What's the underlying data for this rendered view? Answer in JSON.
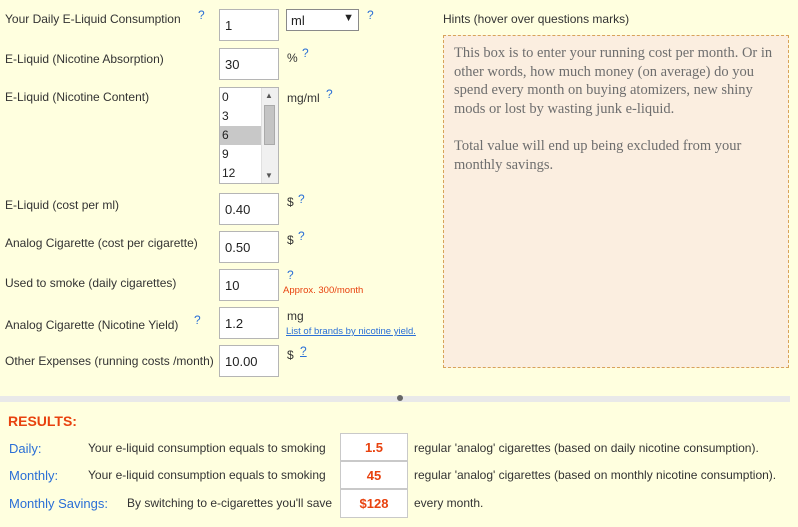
{
  "form": {
    "daily_consumption": {
      "label": "Your Daily E-Liquid Consumption",
      "value": "1",
      "unit_selected": "ml"
    },
    "nicotine_absorption": {
      "label": "E-Liquid (Nicotine Absorption)",
      "value": "30",
      "unit": "%"
    },
    "nicotine_content": {
      "label": "E-Liquid (Nicotine Content)",
      "options": [
        "0",
        "3",
        "6",
        "9",
        "12"
      ],
      "selected": "6",
      "unit": "mg/ml"
    },
    "cost_per_ml": {
      "label": "E-Liquid (cost per ml)",
      "value": "0.40",
      "unit": "$"
    },
    "cost_per_cigarette": {
      "label": "Analog Cigarette (cost per cigarette)",
      "value": "0.50",
      "unit": "$"
    },
    "daily_cigarettes": {
      "label": "Used to smoke (daily cigarettes)",
      "value": "10",
      "note": "Approx. 300/month"
    },
    "nicotine_yield": {
      "label": "Analog Cigarette (Nicotine Yield)",
      "value": "1.2",
      "unit": "mg",
      "link": "List of brands by nicotine yield."
    },
    "other_expenses": {
      "label": "Other Expenses (running costs /month)",
      "value": "10.00",
      "unit": "$"
    },
    "question_mark": "?"
  },
  "hints": {
    "title": "Hints (hover over questions marks)",
    "paragraph1": "This box is to enter your running cost per month. Or in other words, how much money (on average) do you spend every month on buying atomizers, new shiny mods or lost by wasting junk e-liquid.",
    "paragraph2": "Total value will end up being excluded from your monthly savings."
  },
  "results": {
    "title": "RESULTS:",
    "daily": {
      "label": "Daily:",
      "prefix": "Your e-liquid consumption equals to smoking",
      "value": "1.5",
      "suffix": "regular 'analog' cigarettes (based on daily nicotine consumption)."
    },
    "monthly": {
      "label": "Monthly:",
      "prefix": "Your e-liquid consumption equals to smoking",
      "value": "45",
      "suffix": "regular 'analog' cigarettes (based on monthly nicotine consumption)."
    },
    "savings": {
      "label": "Monthly Savings:",
      "prefix": "By switching to e-cigarettes you'll save",
      "value": "$128",
      "suffix": "every month."
    }
  },
  "colors": {
    "background": "#ffffdf",
    "accent": "#e8420f",
    "link": "#2a6fd6",
    "hint_bg": "#fbeee0",
    "hint_border": "#d8a35a"
  }
}
